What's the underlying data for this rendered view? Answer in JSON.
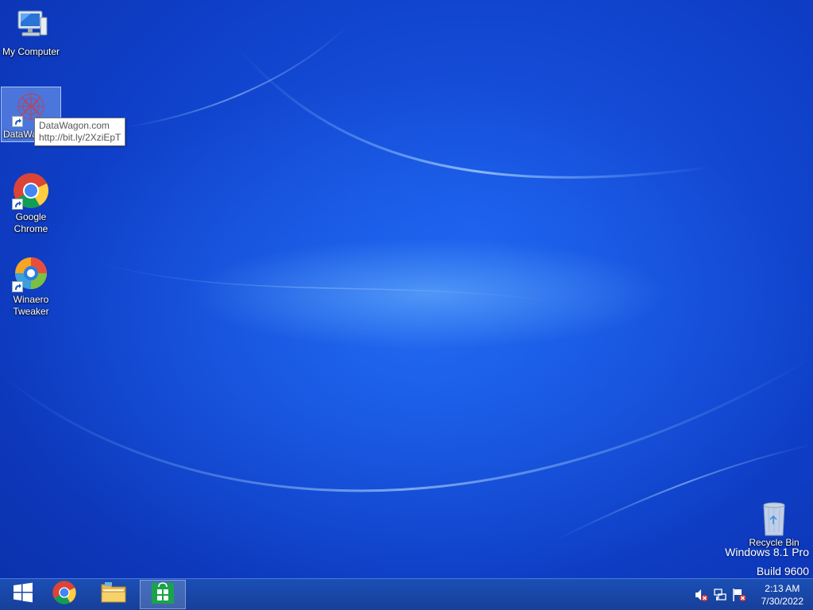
{
  "desktop": {
    "icons": [
      {
        "label": "My Computer",
        "icon": "computer-icon"
      },
      {
        "label": "DataWa",
        "icon": "datawagon-icon",
        "selected": true
      },
      {
        "label": "Google Chrome",
        "icon": "chrome-icon"
      },
      {
        "label": "Winaero Tweaker",
        "icon": "winaero-tweaker-icon"
      },
      {
        "label": "Recycle Bin",
        "icon": "recycle-bin-icon"
      }
    ],
    "tooltip": {
      "line1": "DataWagon.com",
      "line2": "http://bit.ly/2XziEpT"
    },
    "watermark": {
      "edition": "Windows 8.1 Pro",
      "build": "Build 9600"
    }
  },
  "taskbar": {
    "buttons": [
      {
        "name": "start",
        "icon": "windows-logo-icon"
      },
      {
        "name": "chrome",
        "icon": "chrome-icon"
      },
      {
        "name": "file-explorer",
        "icon": "folder-icon"
      },
      {
        "name": "store",
        "icon": "store-icon",
        "active": true
      }
    ],
    "tray": {
      "icons": [
        "speaker-muted-icon",
        "network-icon",
        "action-center-flag-icon"
      ]
    },
    "clock": {
      "time": "2:13 AM",
      "date": "7/30/2022"
    }
  },
  "colors": {
    "wallpaper": "#1a5ae6",
    "taskbar": "#1b4fb5"
  }
}
